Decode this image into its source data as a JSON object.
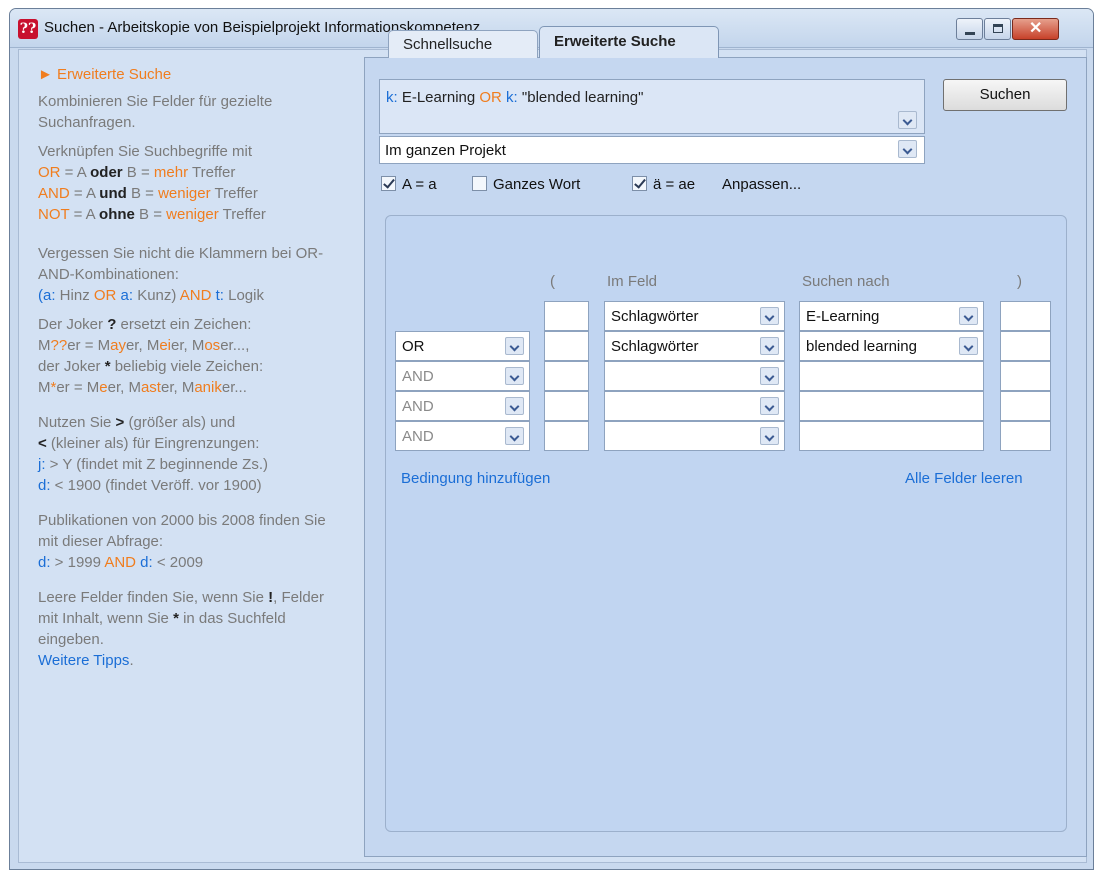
{
  "window": {
    "title": "Suchen - Arbeitskopie von Beispielprojekt Informationskompetenz",
    "icon_text": "??",
    "close_glyph": "✕"
  },
  "help": {
    "header": "► Erweiterte Suche",
    "p1": "Kombinieren Sie Felder für gezielte Suchanfragen.",
    "p2_intro": "Verknüpfen Sie Suchbegriffe mit",
    "or_line": {
      "op": "OR",
      "a": " = A ",
      "word": "oder",
      "b": " B = ",
      "res": "mehr",
      "tail": " Treffer"
    },
    "and_line": {
      "op": "AND",
      "a": " = A ",
      "word": "und",
      "b": " B  = ",
      "res": "weniger",
      "tail": " Treffer"
    },
    "not_line": {
      "op": "NOT",
      "a": " = A ",
      "word": "ohne",
      "b": " B = ",
      "res": "weniger",
      "tail": " Treffer"
    },
    "p3_a": "Vergessen Sie nicht die Klammern bei OR-AND-Kombinationen:",
    "p3_ex": {
      "p1": "(",
      "f1": "a:",
      "t1": " Hinz ",
      "or": "OR",
      "f2": " a:",
      "t2": " Kunz) ",
      "and": "AND",
      "f3": " t:",
      "t3": " Logik"
    },
    "p4_a": "Der Joker ",
    "p4_q": "?",
    "p4_b": " ersetzt ein Zeichen:",
    "p4_ex1": {
      "m": "M",
      "q": "??",
      "rest": "er = M",
      "a": "ay",
      "r2": "er, M",
      "e": "ei",
      "r3": "er, M",
      "o": "os",
      "r4": "er...,"
    },
    "p4_c": "der Joker ",
    "p4_star": "*",
    "p4_d": " beliebig viele Zeichen:",
    "p4_ex2": {
      "m": "M",
      "s": "*",
      "rest": "er = M",
      "a": "e",
      "r2": "er, M",
      "b": "ast",
      "r3": "er, M",
      "c": "anik",
      "r4": "er..."
    },
    "p5_a": "Nutzen Sie ",
    "p5_gt": ">",
    "p5_b": " (größer als) und",
    "p5_lt": "<",
    "p5_c": " (kleiner als) für Eingrenzungen:",
    "p5_j": "j:",
    "p5_jt": " > Y (findet mit Z beginnende Zs.)",
    "p5_d": "d:",
    "p5_dt": " < 1900 (findet Veröff. vor 1900)",
    "p6_a": "Publikationen von 2000 bis 2008 finden Sie mit dieser Abfrage:",
    "p6_d1": "d:",
    "p6_t1": " > 1999 ",
    "p6_and": "AND",
    "p6_d2": " d:",
    "p6_t2": " < 2009",
    "p7_a": "Leere Felder finden Sie, wenn Sie ",
    "p7_ex": "!",
    "p7_b": ", Felder mit Inhalt, wenn Sie ",
    "p7_star": "*",
    "p7_c": " in das Suchfeld eingeben.",
    "p7_link": "Weitere Tipps",
    "p7_dot": "."
  },
  "tabs": {
    "quick": "Schnellsuche",
    "advanced": "Erweiterte Suche"
  },
  "query": {
    "k1": "k:",
    "t1": " E-Learning ",
    "or": "OR",
    "k2": " k:",
    "t2": " \"blended learning\""
  },
  "scope": "Im ganzen Projekt",
  "search_button": "Suchen",
  "options": {
    "case": "A = a",
    "whole_word": "Ganzes Wort",
    "umlaut": "ä = ae",
    "customize": "Anpassen..."
  },
  "columns": {
    "open": "(",
    "field": "Im Feld",
    "search": "Suchen nach",
    "close": ")"
  },
  "rows": [
    {
      "op": "",
      "field": "Schlagwörter",
      "value": "E-Learning"
    },
    {
      "op": "OR",
      "field": "Schlagwörter",
      "value": "blended learning"
    },
    {
      "op": "AND",
      "field": "",
      "value": ""
    },
    {
      "op": "AND",
      "field": "",
      "value": ""
    },
    {
      "op": "AND",
      "field": "",
      "value": ""
    }
  ],
  "actions": {
    "add": "Bedingung hinzufügen",
    "clear": "Alle Felder leeren"
  }
}
